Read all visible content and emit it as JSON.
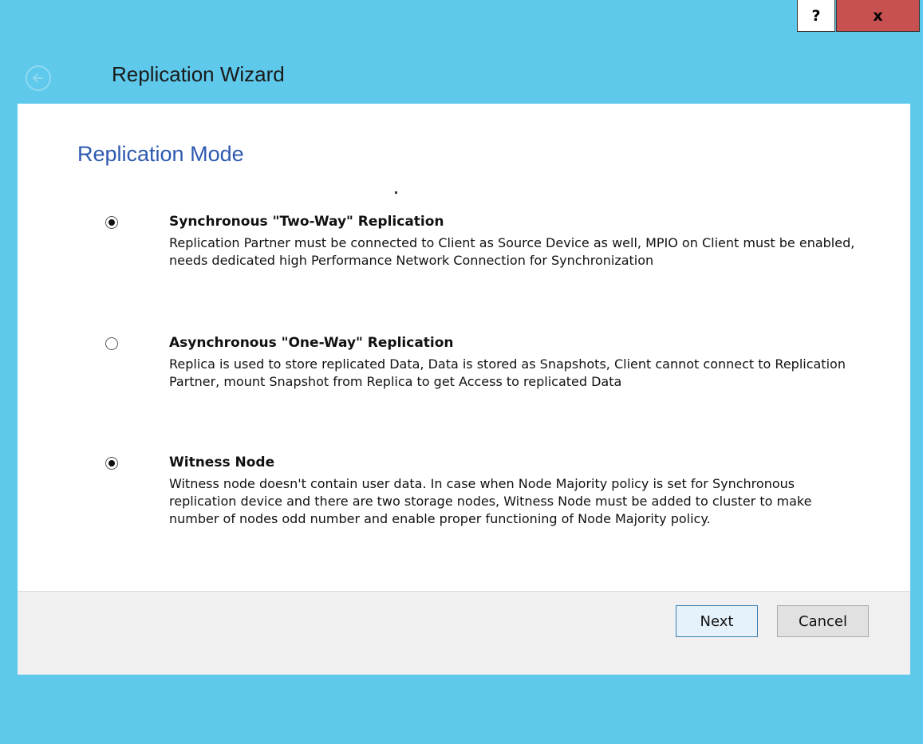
{
  "window": {
    "title": "Replication Wizard",
    "help_label": "?",
    "close_label": "x"
  },
  "page": {
    "title": "Replication Mode"
  },
  "options": [
    {
      "label": "Synchronous \"Two-Way\" Replication",
      "description": "Replication Partner must be connected to Client as Source Device as well, MPIO on Client must be enabled, needs dedicated high Performance Network Connection for Synchronization",
      "checked": true
    },
    {
      "label": "Asynchronous \"One-Way\" Replication",
      "description": "Replica is used to store replicated Data, Data is stored as Snapshots, Client cannot connect to Replication Partner, mount Snapshot from Replica to get Access to replicated Data",
      "checked": false
    },
    {
      "label": "Witness Node",
      "description": "Witness node doesn't contain user data. In case when Node Majority policy is set for Synchronous replication device and there are two storage nodes, Witness Node must be added to cluster to make number of nodes odd number and enable proper functioning of Node Majority policy.",
      "checked": true
    }
  ],
  "footer": {
    "next_label": "Next",
    "cancel_label": "Cancel"
  },
  "colors": {
    "titlebar": "#5ec9eb",
    "close_button": "#c75050",
    "page_title": "#2e5ab0"
  },
  "icons": {
    "back": "back-arrow-icon"
  }
}
